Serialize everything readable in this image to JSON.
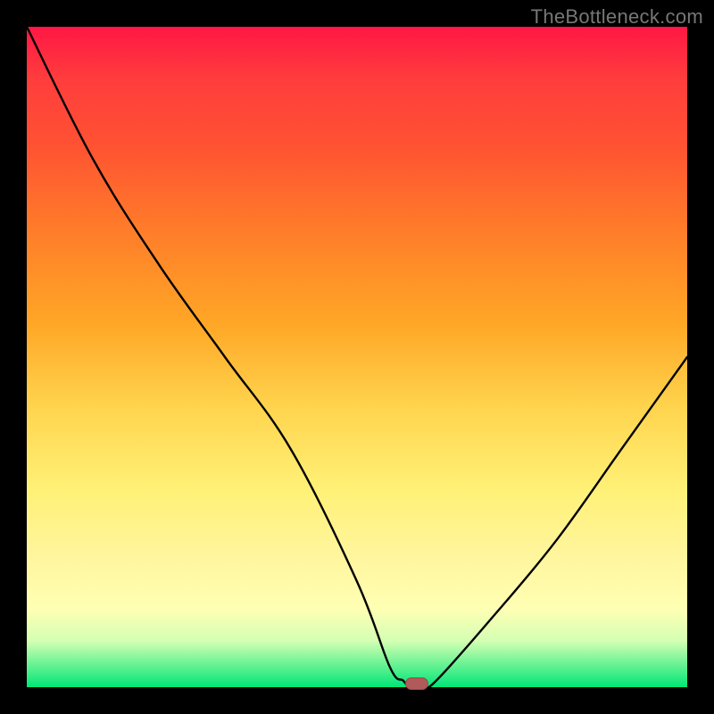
{
  "watermark": "TheBottleneck.com",
  "chart_data": {
    "type": "line",
    "title": "",
    "xlabel": "",
    "ylabel": "",
    "xlim": [
      0,
      100
    ],
    "ylim": [
      0,
      100
    ],
    "grid": false,
    "series": [
      {
        "name": "curve",
        "x": [
          0,
          10,
          20,
          30,
          40,
          50,
          55,
          57,
          58,
          60,
          62,
          70,
          80,
          90,
          100
        ],
        "values": [
          100,
          80,
          64,
          50,
          36,
          16,
          3,
          1,
          0,
          0,
          1,
          10,
          22,
          36,
          50
        ]
      }
    ],
    "marker": {
      "x": 59,
      "y": 0.5,
      "color": "#b05a5a"
    }
  }
}
